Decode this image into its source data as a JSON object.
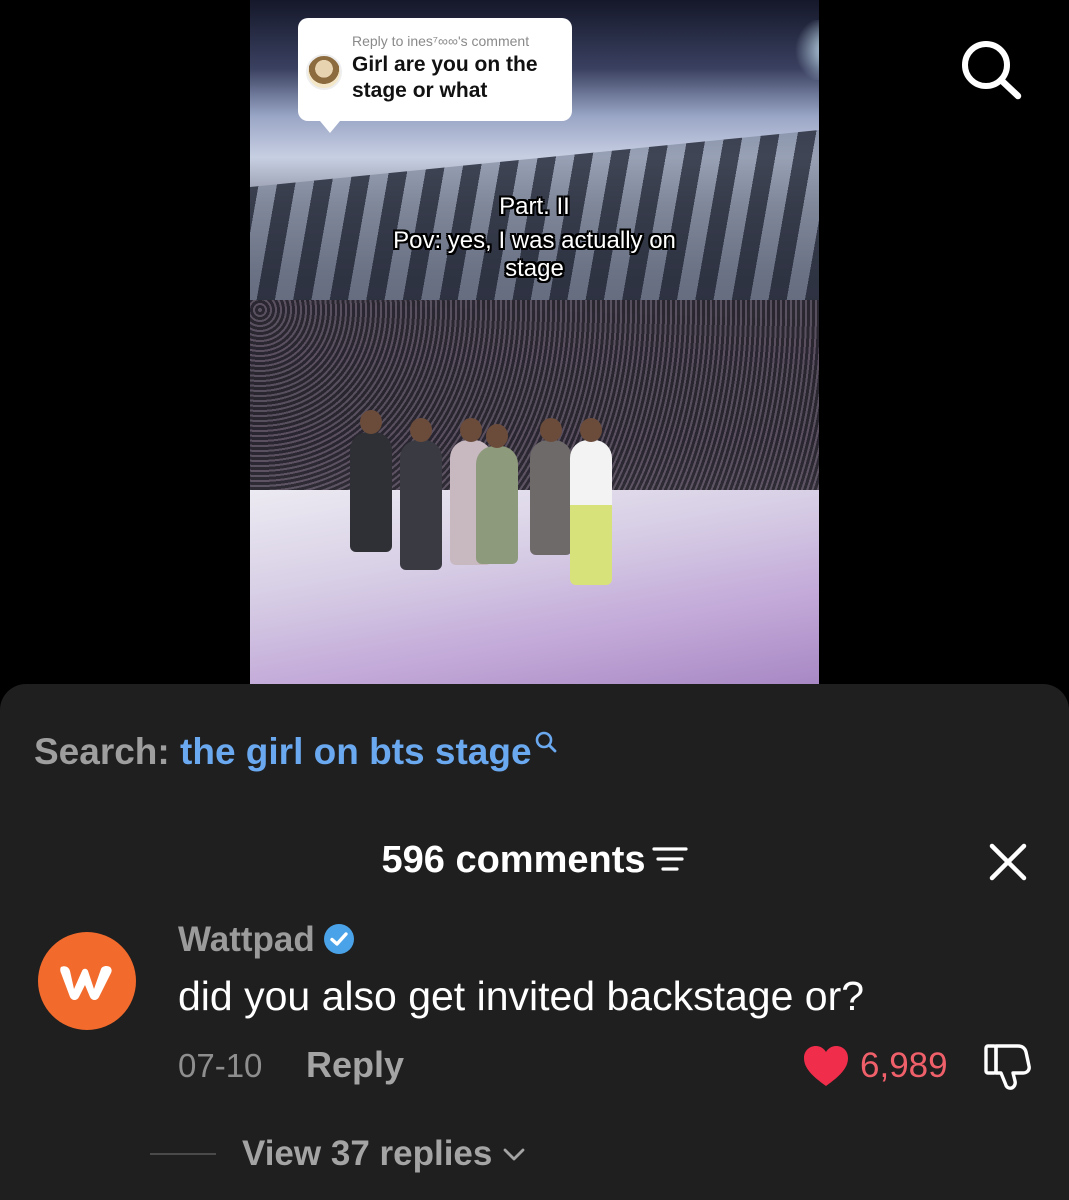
{
  "video": {
    "reply_bubble": {
      "header": "Reply to ines⁷∞∞'s comment",
      "text_line1": "Girl are you on the",
      "text_line2": "stage or what"
    },
    "caption": {
      "line1": "Part. II",
      "line2": "Pov: yes, I was actually on",
      "line3": "stage"
    }
  },
  "search_suggestion": {
    "prefix": "Search:",
    "query": "the girl on bts stage"
  },
  "comments_panel": {
    "title": "596 comments",
    "comment": {
      "author": "Wattpad",
      "verified": true,
      "avatar_letter": "w",
      "text": "did you also get invited backstage or?",
      "date": "07-10",
      "reply_label": "Reply",
      "like_count": "6,989",
      "view_replies_label": "View 37 replies"
    }
  },
  "colors": {
    "sheet_background": "#1f1f1f",
    "search_query": "#6aa8f0",
    "like_red": "#f0606a",
    "wattpad_orange": "#f26a2c",
    "verified_blue": "#4aa3e8"
  },
  "icons": [
    "search-icon",
    "sort-icon",
    "close-icon",
    "verified-icon",
    "heart-icon",
    "dislike-icon",
    "chevron-down-icon"
  ]
}
